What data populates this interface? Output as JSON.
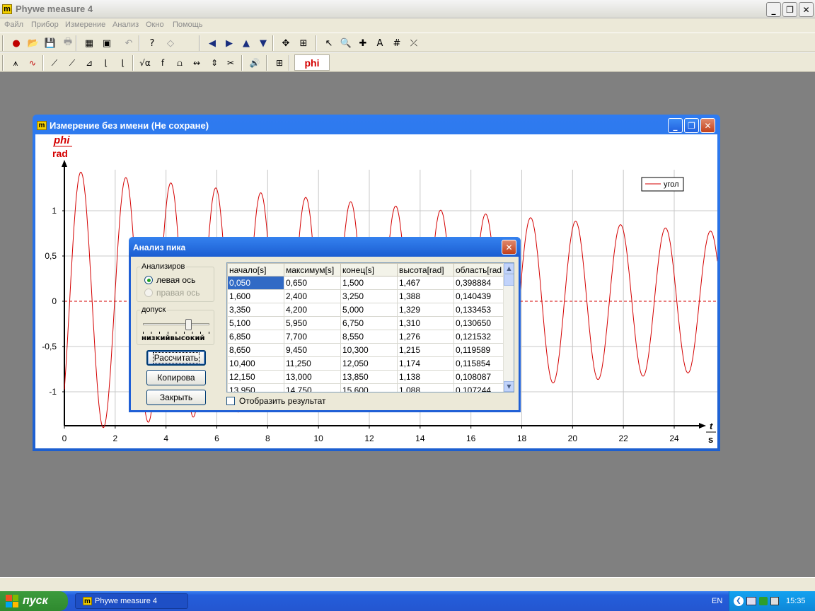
{
  "app": {
    "title": "Phywe measure 4",
    "logo": "m"
  },
  "window_buttons": {
    "minimize": "_",
    "restore": "❐",
    "close": "✕"
  },
  "menu": [
    {
      "label": "Файл"
    },
    {
      "label": "Прибор"
    },
    {
      "label": "Измерение"
    },
    {
      "label": "Анализ"
    },
    {
      "label": "Окно"
    },
    {
      "label": "Помощь"
    }
  ],
  "toolbar1": [
    {
      "icon": "record-icon",
      "glyph": "●",
      "color": "#c00000"
    },
    {
      "icon": "open-folder-icon",
      "glyph": "📂",
      "color": "#c89b00"
    },
    {
      "icon": "save-icon",
      "glyph": "💾",
      "color": "#1a3f8f"
    },
    {
      "icon": "print-icon",
      "glyph": "🖶",
      "color": "#9a9a9a"
    },
    {
      "icon": "table-icon",
      "glyph": "▦",
      "color": "#000"
    },
    {
      "icon": "image-icon",
      "glyph": "▣",
      "color": "#000"
    },
    {
      "icon": "undo-icon",
      "glyph": "↶",
      "color": "#9a9a9a"
    },
    {
      "icon": "help-icon",
      "glyph": "?",
      "color": "#000"
    },
    {
      "icon": "eraser-icon",
      "glyph": "◇",
      "color": "#9a9a9a"
    },
    {
      "icon": "arrow-left-icon",
      "glyph": "◀",
      "color": "#1a2f7f"
    },
    {
      "icon": "arrow-right-icon",
      "glyph": "▶",
      "color": "#1a2f7f"
    },
    {
      "icon": "arrow-up-icon",
      "glyph": "▲",
      "color": "#1a2f7f"
    },
    {
      "icon": "arrow-down-icon",
      "glyph": "▼",
      "color": "#1a2f7f"
    },
    {
      "icon": "move-icon",
      "glyph": "✥",
      "color": "#000"
    },
    {
      "icon": "scale-axes-icon",
      "glyph": "⊞",
      "color": "#000"
    },
    {
      "icon": "pointer-icon",
      "glyph": "↖",
      "color": "#000"
    },
    {
      "icon": "zoom-icon",
      "glyph": "🔍",
      "color": "#000"
    },
    {
      "icon": "crosshair-icon",
      "glyph": "✚",
      "color": "#000"
    },
    {
      "icon": "text-icon",
      "glyph": "A",
      "color": "#000"
    },
    {
      "icon": "grid-icon",
      "glyph": "#",
      "color": "#000"
    },
    {
      "icon": "fit-line-icon",
      "glyph": "⤫",
      "color": "#000"
    }
  ],
  "toolbar2": [
    {
      "icon": "peak-analysis-icon",
      "glyph": "⩚",
      "color": "#000"
    },
    {
      "icon": "smooth-curve-icon",
      "glyph": "∿",
      "color": "#c00000"
    },
    {
      "icon": "tangent-icon",
      "glyph": "⟋",
      "color": "#000"
    },
    {
      "icon": "slope-icon",
      "glyph": "⟋",
      "color": "#000"
    },
    {
      "icon": "integral-icon",
      "glyph": "⊿",
      "color": "#000"
    },
    {
      "icon": "derivative-icon",
      "glyph": "⌊",
      "color": "#000"
    },
    {
      "icon": "regression-icon",
      "glyph": "⌊",
      "color": "#000"
    },
    {
      "icon": "sqrt-icon",
      "glyph": "√α",
      "color": "#000"
    },
    {
      "icon": "function-icon",
      "glyph": "f",
      "color": "#000"
    },
    {
      "icon": "smoothing-icon",
      "glyph": "⩍",
      "color": "#000"
    },
    {
      "icon": "filter-icon",
      "glyph": "↭",
      "color": "#000"
    },
    {
      "icon": "compare-icon",
      "glyph": "⇕",
      "color": "#000"
    },
    {
      "icon": "cut-icon",
      "glyph": "✂",
      "color": "#000"
    },
    {
      "icon": "sound-icon",
      "glyph": "🔊",
      "color": "#000"
    },
    {
      "icon": "channel-icon",
      "glyph": "⊞",
      "color": "#000"
    }
  ],
  "toolbar2_channel": "phi",
  "measurement_window": {
    "title": "Измерение без имени (Не сохране)"
  },
  "chart_data": {
    "type": "line",
    "y_axis": {
      "label": "phi",
      "unit": "rad",
      "ticks": [
        1,
        0.5,
        0,
        -0.5,
        -1
      ],
      "tick_labels": [
        "1",
        "0,5",
        "0",
        "-0,5",
        "-1"
      ],
      "ylim": [
        -1.42,
        1.45
      ]
    },
    "x_axis": {
      "label": "t",
      "unit": "s",
      "ticks": [
        0,
        2,
        4,
        6,
        8,
        10,
        12,
        14,
        16,
        18,
        20,
        22,
        24
      ],
      "xlim": [
        0,
        25.7
      ]
    },
    "grid": true,
    "legend": {
      "position": "top-right",
      "entries": [
        "угол"
      ]
    },
    "zero_line": "dashed",
    "series": [
      {
        "name": "угол",
        "color": "#d40000",
        "model": {
          "amplitude_start": 1.45,
          "amplitude_end": 0.77,
          "period_s": 1.77,
          "peak_time_s": 0.65
        }
      }
    ]
  },
  "dialog": {
    "title": "Анализ пика",
    "analyze_group": "Анализиров",
    "radio_left": "левая ось",
    "radio_right": "правая ось",
    "tolerance_group": "допуск",
    "slider_low": "низкий",
    "slider_high": "высокий",
    "slider_level": 0.7,
    "btn_calc": "Рассчитать",
    "btn_copy": "Копирова",
    "btn_close": "Закрыть",
    "checkbox_show": "Отобразить результат",
    "columns": [
      "начало[s]",
      "максимум[s]",
      "конец[s]",
      "высота[rad]",
      "область[rad"
    ],
    "rows": [
      [
        "0,050",
        "0,650",
        "1,500",
        "1,467",
        "0,398884"
      ],
      [
        "1,600",
        "2,400",
        "3,250",
        "1,388",
        "0,140439"
      ],
      [
        "3,350",
        "4,200",
        "5,000",
        "1,329",
        "0,133453"
      ],
      [
        "5,100",
        "5,950",
        "6,750",
        "1,310",
        "0,130650"
      ],
      [
        "6,850",
        "7,700",
        "8,550",
        "1,276",
        "0,121532"
      ],
      [
        "8,650",
        "9,450",
        "10,300",
        "1,215",
        "0,119589"
      ],
      [
        "10,400",
        "11,250",
        "12,050",
        "1,174",
        "0,115854"
      ],
      [
        "12,150",
        "13,000",
        "13,850",
        "1,138",
        "0,108087"
      ],
      [
        "13,950",
        "14,750",
        "15,600",
        "1,088",
        "0,107244"
      ]
    ]
  },
  "taskbar": {
    "start": "пуск",
    "task": "Phywe measure 4",
    "lang": "EN",
    "clock": "15:35"
  }
}
